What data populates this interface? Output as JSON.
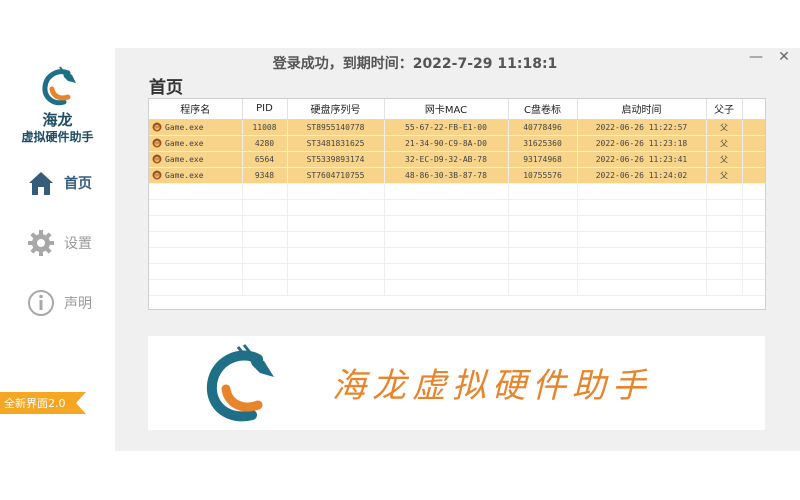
{
  "brand": {
    "line1": "海龙",
    "line2": "虚拟硬件助手"
  },
  "nav": {
    "items": [
      {
        "label": "首页",
        "icon": "home-icon"
      },
      {
        "label": "设置",
        "icon": "gear-icon"
      },
      {
        "label": "声明",
        "icon": "info-icon"
      }
    ]
  },
  "version_badge": "全新界面2.0",
  "status": "登录成功，到期时间：2022-7-29 11:18:1",
  "window": {
    "minimize": "—",
    "close": "✕"
  },
  "page_title": "首页",
  "table": {
    "columns": [
      "程序名",
      "PID",
      "硬盘序列号",
      "网卡MAC",
      "C盘卷标",
      "启动时间",
      "父子"
    ],
    "rows": [
      [
        "Game.exe",
        "11008",
        "ST8955140778",
        "55-67-22-FB-E1-00",
        "40778496",
        "2022-06-26 11:22:57",
        "父"
      ],
      [
        "Game.exe",
        "4280",
        "ST3481831625",
        "21-34-90-C9-8A-D0",
        "31625360",
        "2022-06-26 11:23:18",
        "父"
      ],
      [
        "Game.exe",
        "6564",
        "ST5339893174",
        "32-EC-D9-32-AB-78",
        "93174968",
        "2022-06-26 11:23:41",
        "父"
      ],
      [
        "Game.exe",
        "9348",
        "ST7604710755",
        "48-86-30-3B-87-78",
        "10755576",
        "2022-06-26 11:24:02",
        "父"
      ]
    ],
    "empty_rows": 7
  },
  "banner": {
    "text": "海龙虚拟硬件助手"
  },
  "colors": {
    "accent": "#355d79",
    "row_highlight": "#f7d48a",
    "badge": "#f5a623",
    "brand_orange": "#e8842a",
    "brand_teal": "#1f6f86"
  }
}
